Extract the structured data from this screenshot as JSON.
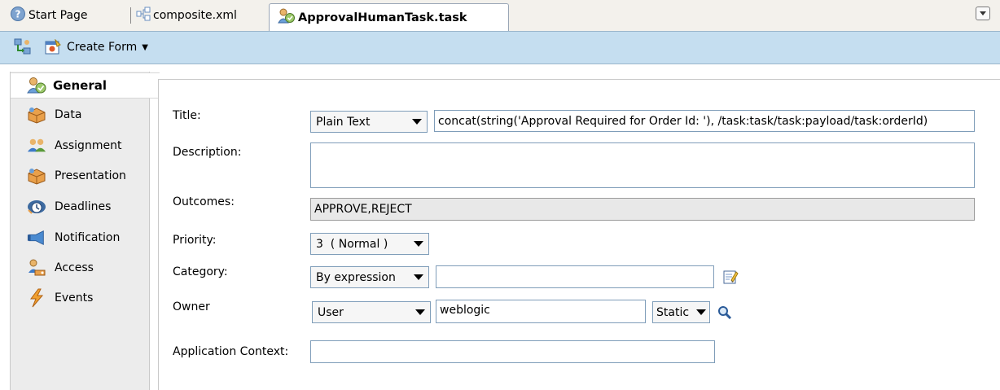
{
  "tabs": [
    {
      "label": "Start Page",
      "icon": "help-icon",
      "active": false
    },
    {
      "label": "composite.xml",
      "icon": "composite-icon",
      "active": false
    },
    {
      "label": "ApprovalHumanTask.task",
      "icon": "human-task-icon",
      "active": true
    }
  ],
  "toolbar": {
    "create_form_label": "Create Form"
  },
  "nav": {
    "items": [
      {
        "label": "General",
        "icon": "general-icon",
        "active": true
      },
      {
        "label": "Data",
        "icon": "data-icon"
      },
      {
        "label": "Assignment",
        "icon": "assignment-icon"
      },
      {
        "label": "Presentation",
        "icon": "presentation-icon"
      },
      {
        "label": "Deadlines",
        "icon": "deadlines-icon"
      },
      {
        "label": "Notification",
        "icon": "notification-icon"
      },
      {
        "label": "Access",
        "icon": "access-icon"
      },
      {
        "label": "Events",
        "icon": "events-icon"
      }
    ]
  },
  "form": {
    "title_label": "Title:",
    "title_mode": "Plain Text",
    "title_value": "concat(string('Approval Required for Order Id: '), /task:task/task:payload/task:orderId)",
    "description_label": "Description:",
    "description_value": "",
    "outcomes_label": "Outcomes:",
    "outcomes_value": "APPROVE,REJECT",
    "priority_label": "Priority:",
    "priority_value": "3  ( Normal )",
    "category_label": "Category:",
    "category_mode": "By expression",
    "category_value": "",
    "owner_label": "Owner",
    "owner_type": "User",
    "owner_value": "weblogic",
    "owner_mode": "Static",
    "app_context_label": "Application Context:",
    "app_context_value": ""
  },
  "colors": {
    "toolbar_bg": "#c5def0",
    "nav_bg": "#ececec",
    "field_border": "#7f9db9"
  }
}
